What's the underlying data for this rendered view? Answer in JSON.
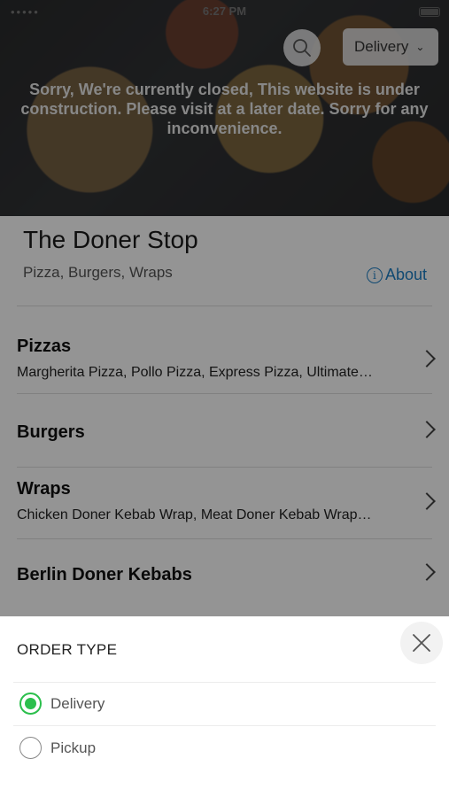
{
  "status_bar": {
    "carrier": "•••••",
    "time": "6:27 PM"
  },
  "header": {
    "order_type_button": "Delivery",
    "closed_message": "Sorry, We're currently closed, This website is under construction. Please visit at a later date. Sorry for any inconvenience."
  },
  "restaurant": {
    "name": "The Doner Stop",
    "cuisines": "Pizza, Burgers, Wraps",
    "about_label": "About"
  },
  "categories": [
    {
      "name": "Pizzas",
      "description": "Margherita Pizza, Pollo Pizza, Express Pizza, Ultimate…"
    },
    {
      "name": "Burgers",
      "description": ""
    },
    {
      "name": "Wraps",
      "description": "Chicken Doner Kebab Wrap, Meat Doner Kebab Wrap…"
    },
    {
      "name": "Berlin Doner Kebabs",
      "description": ""
    }
  ],
  "order_sheet": {
    "title": "ORDER TYPE",
    "options": [
      {
        "label": "Delivery",
        "selected": true
      },
      {
        "label": "Pickup",
        "selected": false
      }
    ],
    "accent_color": "#2bbf4c"
  }
}
